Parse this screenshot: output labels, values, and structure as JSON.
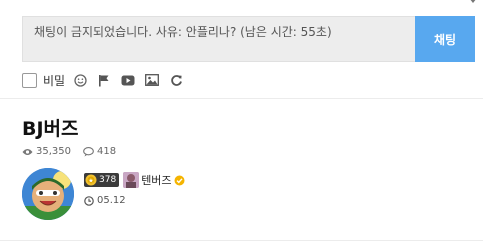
{
  "chat": {
    "message": "채팅이 금지되었습니다. 사유: 안플리나? (남은 시간: 55초)",
    "send_label": "채팅"
  },
  "tools": {
    "secret_label": "비밀",
    "icons": [
      "smile-icon",
      "flag-icon",
      "youtube-icon",
      "image-icon",
      "refresh-icon"
    ]
  },
  "broadcaster": {
    "name": "BJ버즈",
    "views": "35,350",
    "comments": "418",
    "user_level": "378",
    "nickname": "텐버즈",
    "date": "05.12"
  },
  "colors": {
    "send_button": "#58a8ef",
    "verified_badge": "#f5b400"
  }
}
